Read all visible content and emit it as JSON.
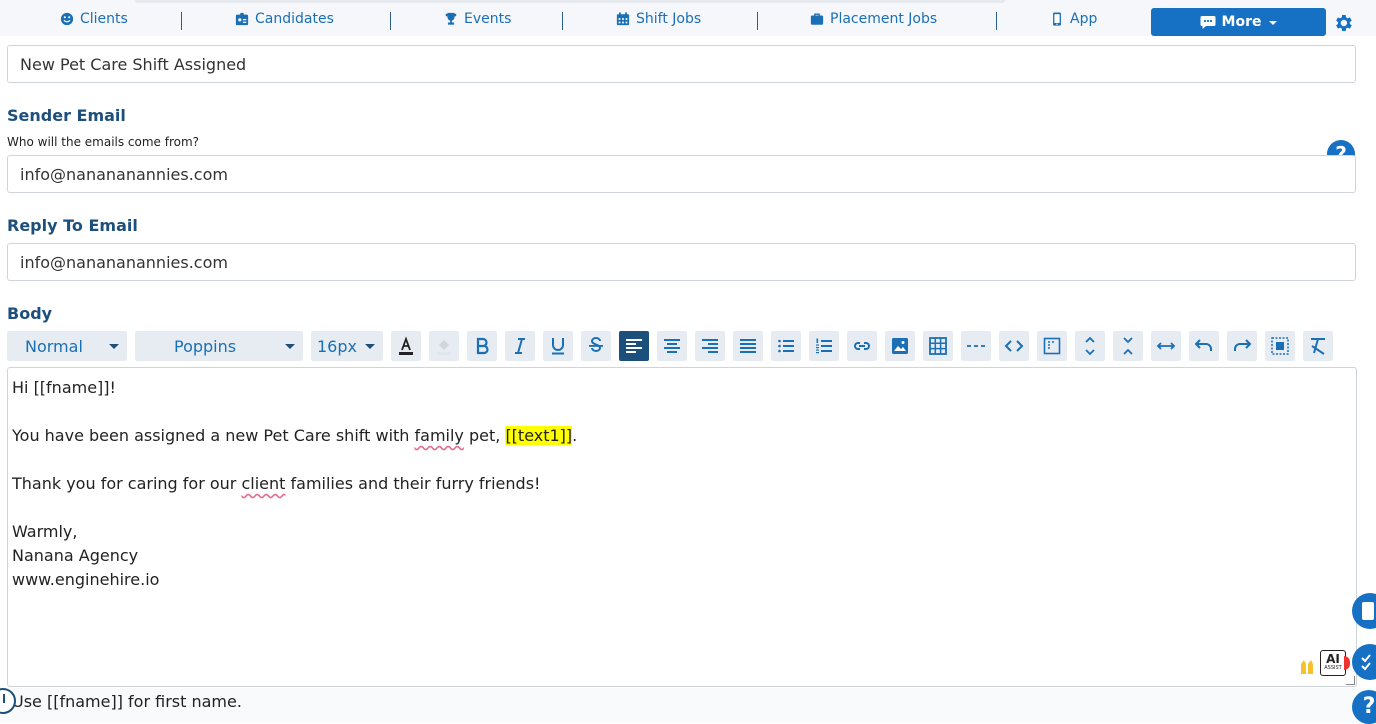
{
  "nav": {
    "items": [
      {
        "label": "Clients",
        "icon": "smile-icon"
      },
      {
        "label": "Candidates",
        "icon": "id-card-icon"
      },
      {
        "label": "Events",
        "icon": "trophy-icon"
      },
      {
        "label": "Shift Jobs",
        "icon": "calendar-icon"
      },
      {
        "label": "Placement Jobs",
        "icon": "briefcase-icon"
      },
      {
        "label": "App",
        "icon": "mobile-icon"
      }
    ],
    "more_label": "More",
    "accent": "#1670c4"
  },
  "form": {
    "subject_value": "New Pet Care Shift Assigned",
    "sender_label": "Sender Email",
    "sender_help": "Who will the emails come from?",
    "sender_value": "info@nanananannies.com",
    "reply_label": "Reply To Email",
    "reply_value": "info@nanananannies.com",
    "body_label": "Body"
  },
  "toolbar": {
    "style_select": "Normal",
    "font_select": "Poppins",
    "size_select": "16px"
  },
  "editor": {
    "line1": "Hi [[fname]]!",
    "line2_prefix": "You have been assigned a new Pet Care shift with ",
    "line2_word": "family",
    "line2_mid": " pet, ",
    "line2_highlight": "[[text1]]",
    "line2_suffix": ".",
    "line3_prefix": "Thank you for caring for our ",
    "line3_word": "client",
    "line3_suffix": " families and their furry friends!",
    "line4": "Warmly,",
    "line5": "Nanana Agency",
    "line6": "www.enginehire.io"
  },
  "hint": "Use [[fname]] for first name.",
  "ai_badge": "AI",
  "ai_badge_sub": "ASSIST"
}
